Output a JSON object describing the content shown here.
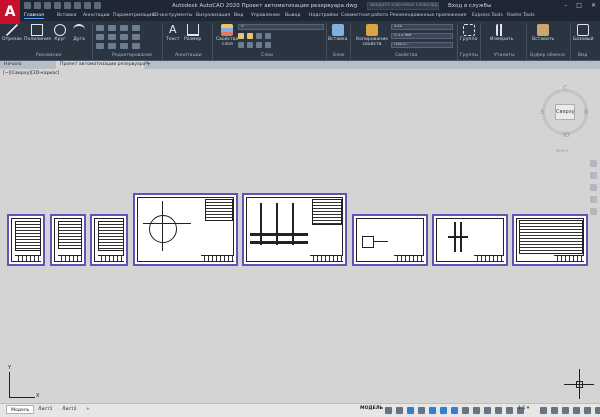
{
  "app": {
    "logo": "A",
    "title": "Autodesk AutoCAD 2020   Проект автоматизации резервуара.dwg",
    "search_placeholder": "Введите ключевое слово/фразу",
    "signin": "Вход в службы"
  },
  "ribbon_tabs": [
    "Главная",
    "Вставка",
    "Аннотации",
    "Параметризация",
    "3D-инструменты",
    "Визуализация",
    "Вид",
    "Управление",
    "Вывод",
    "Надстройки",
    "Совместная работа",
    "Рекомендованные приложения",
    "Express Tools",
    "Raster Tools"
  ],
  "ribbon": {
    "draw_tools": [
      "Отрезок",
      "Полилиния",
      "Круг",
      "Дуга"
    ],
    "draw_panel": "Рисование",
    "modify_panel": "Редактирование",
    "annot_tools": [
      "Текст",
      "Размер"
    ],
    "annot_panel": "Аннотации",
    "layer_props": "Свойства\nслоя",
    "layer_value": "0",
    "layers_panel": "Слои",
    "insert_btn": "Вставка",
    "block_panel": "Блок",
    "match_props": "Копирование\nсвойств",
    "props_color": "250",
    "props_lineweight": "0.15 мм",
    "props_linetype": "ПоСл...",
    "props_panel": "Свойства",
    "group_btn": "Группа",
    "groups_panel": "Группы",
    "measure_btn": "Измерить",
    "utilities_panel": "Утилиты",
    "paste_btn": "Вставить",
    "clipboard_panel": "Буфер обмена",
    "base_btn": "Базовый",
    "view_panel": "Вид"
  },
  "file_tabs": {
    "start": "Начало",
    "current": "Проект автоматизации резервуара*",
    "plus": "+"
  },
  "viewport": {
    "label": "[−][Сверху][2D-каркас]"
  },
  "viewcube": {
    "face": "Сверху",
    "north": "С",
    "south": "Ю",
    "west": "З",
    "east": "В",
    "wcs": "МСК ▾"
  },
  "ucs": {
    "x": "X",
    "y": "Y"
  },
  "status": {
    "tabs": [
      "Модель",
      "Лист1",
      "Лист2"
    ],
    "add": "+",
    "model": "МОДЕЛЬ",
    "scale": "1:1 ▾"
  },
  "colors": {
    "chrome": "#1e2733",
    "ribbon": "#2b3541",
    "canvas": "#d4d4d4",
    "sheet_frame": "#5c55b6",
    "accent": "#2f7fd4",
    "logo": "#c8102e"
  }
}
